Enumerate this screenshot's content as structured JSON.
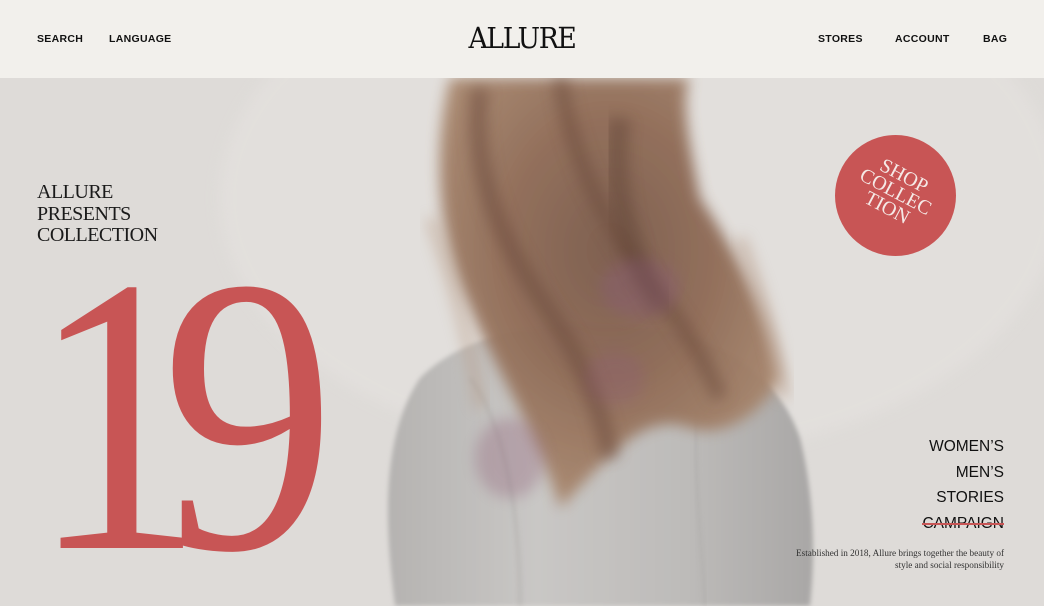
{
  "header": {
    "search_label": "SEARCH",
    "language_label": "LANGUAGE",
    "logo_text": "ALLURE",
    "stores_label": "STORES",
    "account_label": "ACCOUNT",
    "bag_label": "BAG"
  },
  "hero": {
    "presents_text": "ALLURE\nPRESENTS\nCOLLECTION",
    "big_number": "19",
    "shop_badge_text": "SHOP\nCOLLEC\nTION",
    "menu": {
      "womens": "WOMEN’S",
      "mens": "MEN’S",
      "stories": "STORIES",
      "campaign": "CAMPAIGN"
    },
    "tagline": "Established in 2018, Allure brings together the beauty of style and social responsibility"
  },
  "colors": {
    "accent": "#c85555",
    "header_bg": "#f2f0ec",
    "hero_bg": "#dcd9d6",
    "text": "#111111"
  }
}
